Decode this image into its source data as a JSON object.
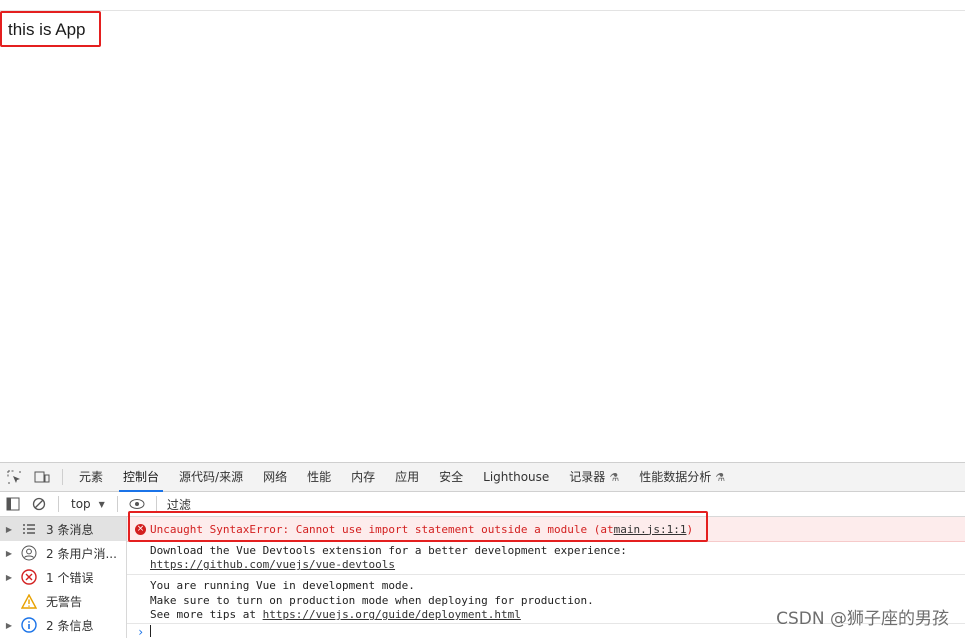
{
  "page": {
    "app_text": "this is App"
  },
  "devtools": {
    "tabs": [
      {
        "label": "元素"
      },
      {
        "label": "控制台",
        "active": true
      },
      {
        "label": "源代码/来源"
      },
      {
        "label": "网络"
      },
      {
        "label": "性能"
      },
      {
        "label": "内存"
      },
      {
        "label": "应用"
      },
      {
        "label": "安全"
      },
      {
        "label": "Lighthouse"
      },
      {
        "label": "记录器"
      },
      {
        "label": "性能数据分析"
      }
    ],
    "filterbar": {
      "context": "top",
      "filter_label": "过滤"
    },
    "sidebar": {
      "items": [
        {
          "label": "3 条消息",
          "icon": "list-icon"
        },
        {
          "label": "2 条用户消...",
          "icon": "user-icon"
        },
        {
          "label": "1 个错误",
          "icon": "error-icon"
        },
        {
          "label": "无警告",
          "icon": "warning-icon"
        },
        {
          "label": "2 条信息",
          "icon": "info-icon"
        }
      ]
    },
    "console": {
      "error": {
        "text": "Uncaught SyntaxError: Cannot use import statement outside a module (at ",
        "link": "main.js:1:1",
        "suffix": ")"
      },
      "devtools_msg": {
        "line1": "Download the Vue Devtools extension for a better development experience:",
        "link": "https://github.com/vuejs/vue-devtools"
      },
      "vue_msg": {
        "line1": "You are running Vue in development mode.",
        "line2": "Make sure to turn on production mode when deploying for production.",
        "line3_prefix": "See more tips at ",
        "line3_link": "https://vuejs.org/guide/deployment.html"
      },
      "prompt": "›"
    },
    "colors": {
      "error": "#d32020",
      "accent": "#1a73e8",
      "highlight": "#e41f1f"
    }
  },
  "watermark": "CSDN @狮子座的男孩"
}
